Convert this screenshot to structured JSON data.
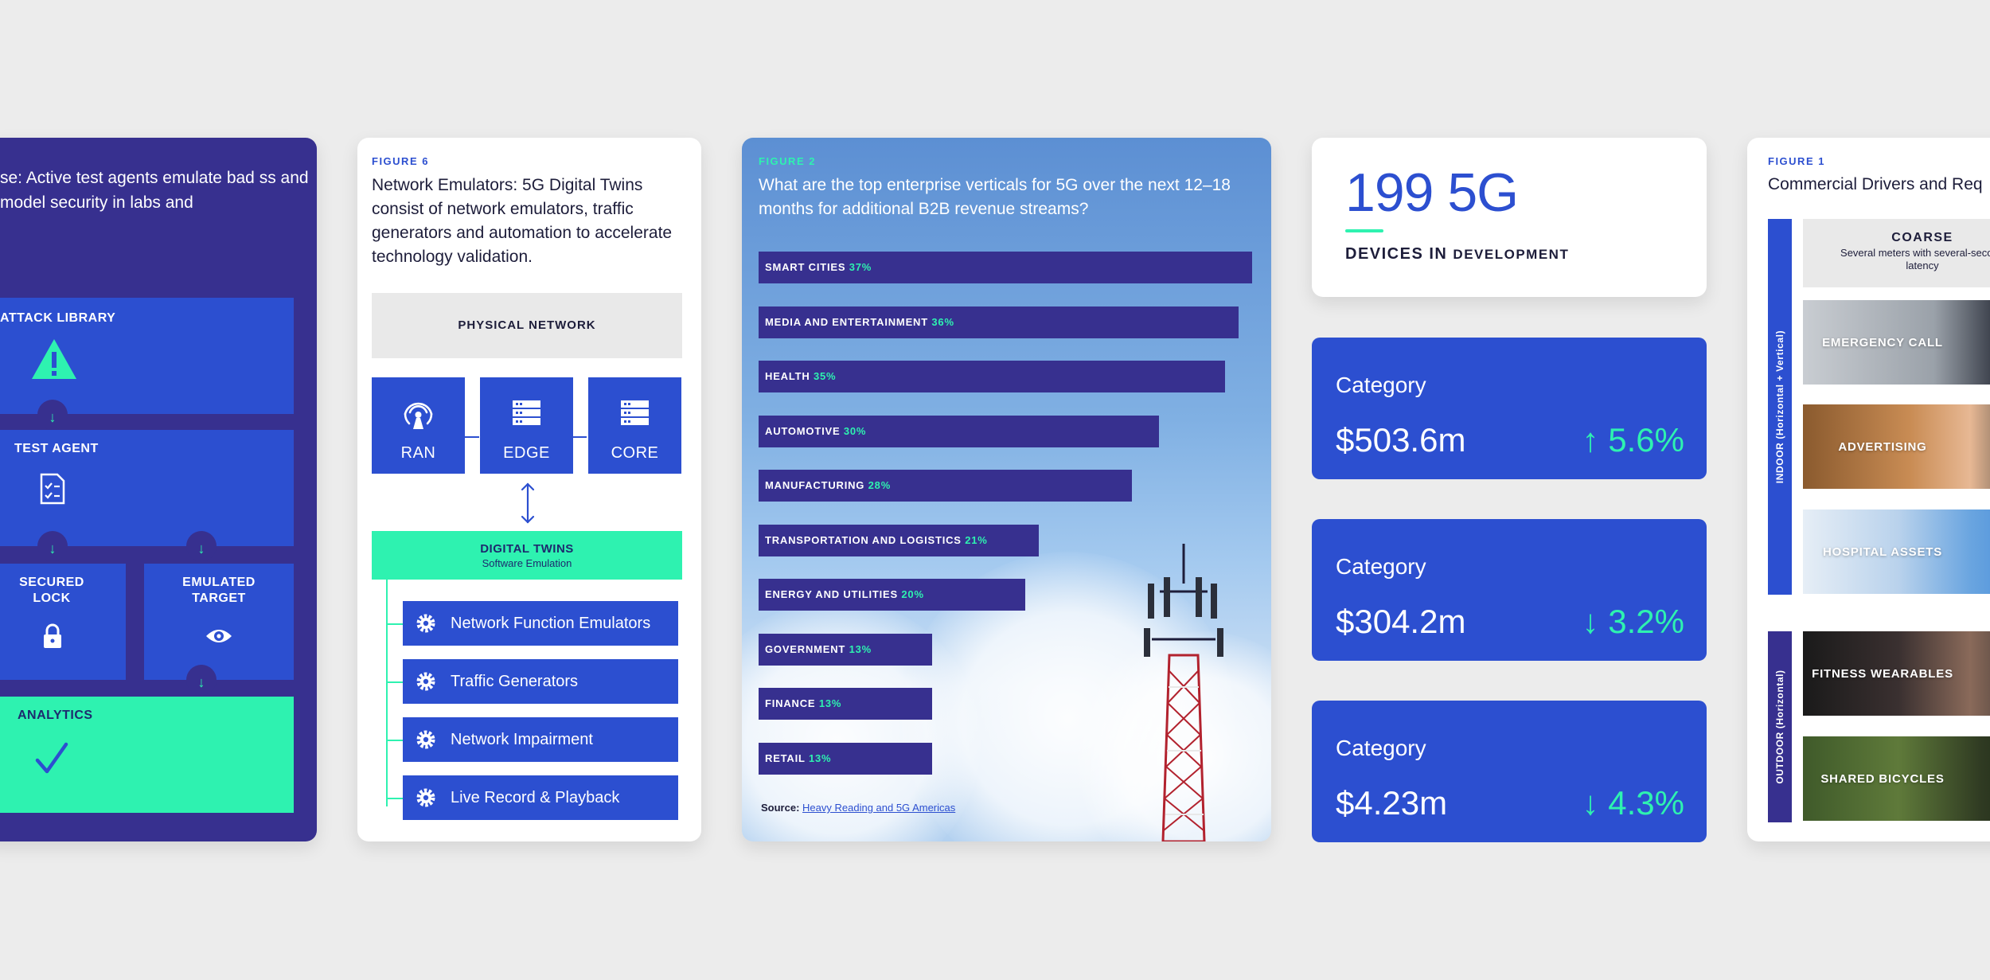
{
  "card1": {
    "intro": "se: Active test agents emulate bad ss and model security in labs and",
    "attack_library": "ATTACK LIBRARY",
    "test_agent": "TEST AGENT",
    "secured_lock": "SECURED LOCK",
    "emulated_target": "EMULATED TARGET",
    "analytics": "ANALYTICS"
  },
  "card2": {
    "figure": "FIGURE 6",
    "title": "Network Emulators: 5G Digital Twins consist of network emulators, traffic generators and automation to accelerate technology validation.",
    "physical_network": "PHYSICAL NETWORK",
    "nodes": [
      "RAN",
      "EDGE",
      "CORE"
    ],
    "twins_title": "DIGITAL TWINS",
    "twins_sub": "Software Emulation",
    "emulators": [
      "Network Function Emulators",
      "Traffic Generators",
      "Network Impairment",
      "Live Record & Playback"
    ]
  },
  "card3": {
    "figure": "FIGURE 2",
    "title": "What are the top enterprise verticals for 5G over the next 12–18 months for additional B2B revenue streams?",
    "source_label": "Source:",
    "source_link": "Heavy Reading and 5G Americas"
  },
  "chart_data": {
    "type": "bar",
    "orientation": "horizontal",
    "title": "What are the top enterprise verticals for 5G over the next 12–18 months for additional B2B revenue streams?",
    "categories": [
      "SMART CITIES",
      "MEDIA AND ENTERTAINMENT",
      "HEALTH",
      "AUTOMOTIVE",
      "MANUFACTURING",
      "TRANSPORTATION AND LOGISTICS",
      "ENERGY AND UTILITIES",
      "GOVERNMENT",
      "FINANCE",
      "RETAIL"
    ],
    "values": [
      37,
      36,
      35,
      30,
      28,
      21,
      20,
      13,
      13,
      13
    ],
    "value_labels": [
      "37%",
      "36%",
      "35%",
      "30%",
      "28%",
      "21%",
      "20%",
      "13%",
      "13%",
      "13%"
    ],
    "xlim": [
      0,
      37
    ]
  },
  "stats": {
    "headline": "199 5G",
    "headline_label_a": "DEVICES IN",
    "headline_label_b": "DEVELOPMENT",
    "kpis": [
      {
        "category": "Category",
        "value": "$503.6m",
        "change": "↑ 5.6%"
      },
      {
        "category": "Category",
        "value": "$304.2m",
        "change": "↓ 3.2%"
      },
      {
        "category": "Category",
        "value": "$4.23m",
        "change": "↓ 4.3%"
      }
    ]
  },
  "card5": {
    "figure": "FIGURE 1",
    "title": "Commercial Drivers and Req",
    "indoor_label": "INDOOR (Horizontal + Vertical)",
    "outdoor_label": "OUTDOOR (Horizontal)",
    "coarse_title": "COARSE",
    "coarse_desc": "Several meters with several-second latency",
    "photos": [
      "EMERGENCY CALL",
      "ADVERTISING",
      "HOSPITAL ASSETS",
      "FITNESS WEARABLES",
      "SHARED BICYCLES"
    ]
  },
  "colors": {
    "navy": "#37308f",
    "blue": "#2c4fd0",
    "mint": "#2ef2b0",
    "background": "#ececec"
  }
}
